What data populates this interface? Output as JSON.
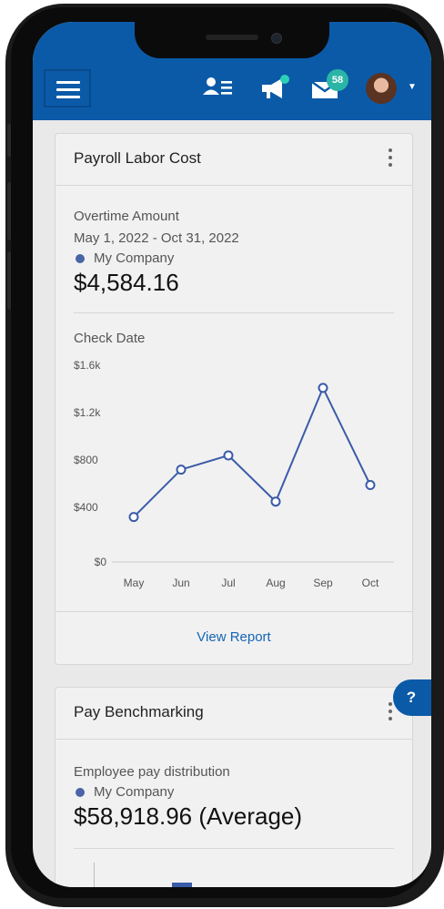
{
  "header": {
    "badge_count": "58",
    "icons": [
      "menu-icon",
      "people-list-icon",
      "megaphone-icon",
      "inbox-icon",
      "avatar",
      "caret-down-icon"
    ],
    "brand_color": "#0b5aa8"
  },
  "payroll_card": {
    "title": "Payroll Labor Cost",
    "metric_label": "Overtime Amount",
    "date_range": "May 1, 2022 - Oct 31, 2022",
    "legend": "My Company",
    "amount": "$4,584.16",
    "chart_label": "Check Date",
    "view_report": "View Report"
  },
  "chart_data": {
    "type": "line",
    "categories": [
      "May",
      "Jun",
      "Jul",
      "Aug",
      "Sep",
      "Oct"
    ],
    "series": [
      {
        "name": "My Company",
        "values": [
          380,
          780,
          900,
          510,
          1470,
          650
        ]
      }
    ],
    "y_ticks": [
      "$0",
      "$400",
      "$800",
      "$1.2k",
      "$1.6k"
    ],
    "ylim": [
      0,
      1600
    ],
    "grid": false,
    "color": "#3a5ba8"
  },
  "benchmark_card": {
    "title": "Pay Benchmarking",
    "subtitle": "Employee pay distribution",
    "legend": "My Company",
    "amount": "$58,918.96 (Average)"
  },
  "help": {
    "label": "?"
  }
}
